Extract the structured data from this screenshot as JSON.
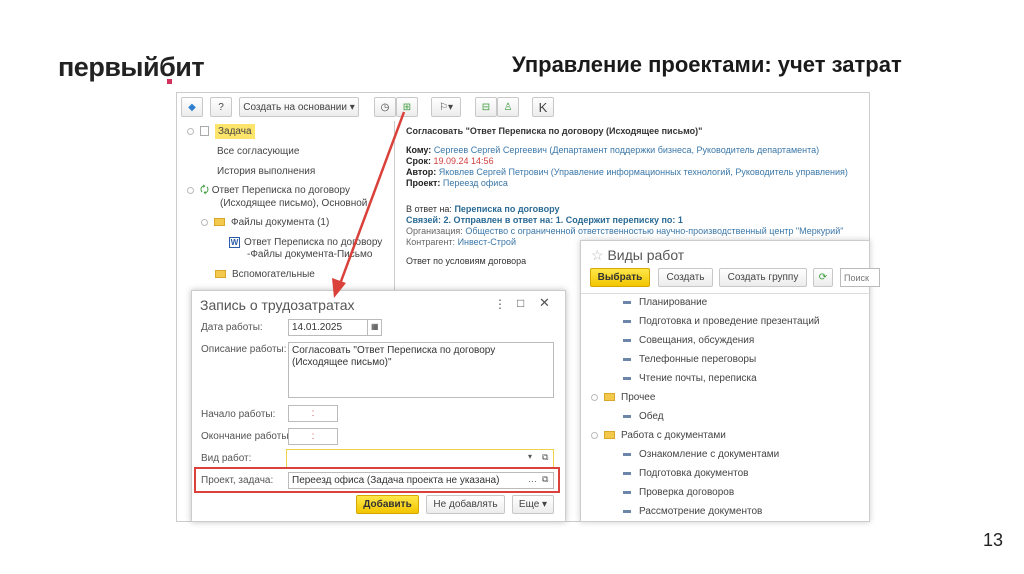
{
  "logo": {
    "text_a": "первый",
    "text_b": "бит",
    "accent": "#d2335c"
  },
  "slide": {
    "title": "Управление проектами: учет затрат",
    "page_number": "13"
  },
  "toolbar": {
    "create_based_on": "Создать на основании",
    "k_label": "K"
  },
  "tree": {
    "items": [
      {
        "label": "Задача"
      },
      {
        "label": "Все согласующие"
      },
      {
        "label": "История выполнения"
      },
      {
        "label": "Ответ Переписка по договору"
      },
      {
        "label": "(Исходящее письмо), Основной"
      },
      {
        "label": "Файлы документа (1)"
      },
      {
        "label": "Ответ Переписка по договору"
      },
      {
        "label": "-Файлы документа-Письмо"
      },
      {
        "label": "Вспомогательные"
      }
    ]
  },
  "task": {
    "heading": "Согласовать \"Ответ Переписка по договору (Исходящее письмо)\"",
    "to_label": "Кому:",
    "to_value": "Сергеев Сергей Сергеевич (Департамент поддержки бизнеса, Руководитель департамента)",
    "due_label": "Срок:",
    "due_value": "19.09.24 14:56",
    "author_label": "Автор:",
    "author_value": "Яковлев Сергей Петрович (Управление информационных технологий, Руководитель управления)",
    "project_label": "Проект:",
    "project_value": "Переезд офиса",
    "reply_label": "В ответ на:",
    "reply_value": "Переписка по договору",
    "links": "Связей: 2. Отправлен в ответ на: 1. Содержит переписку по: 1",
    "org_label": "Организация:",
    "org_value": "Общество с ограниченной ответственностью научно-производственный центр \"Меркурий\"",
    "contr_label": "Контрагент:",
    "contr_value": "Инвест-Строй",
    "note": "Ответ по условиям договора"
  },
  "dialog": {
    "title": "Запись о трудозатратах",
    "date_label": "Дата работы:",
    "date_value": "14.01.2025",
    "desc_label": "Описание работы:",
    "desc_value": "Согласовать \"Ответ Переписка по договору (Исходящее письмо)\"",
    "start_label": "Начало работы:",
    "start_value": ":",
    "end_label": "Окончание работы:",
    "end_value": ":",
    "kind_label": "Вид работ:",
    "kind_value": "",
    "project_label": "Проект, задача:",
    "project_value": "Переезд офиса (Задача проекта не указана)",
    "add": "Добавить",
    "dont_add": "Не добавлять",
    "more": "Еще",
    "highlight_color": "#d9413a"
  },
  "vidy": {
    "title": "Виды работ",
    "select": "Выбрать",
    "create": "Создать",
    "create_group": "Создать группу",
    "search_placeholder": "Поиск",
    "items": [
      {
        "label": "Планирование",
        "type": "item"
      },
      {
        "label": "Подготовка и проведение презентаций",
        "type": "item"
      },
      {
        "label": "Совещания, обсуждения",
        "type": "item"
      },
      {
        "label": "Телефонные переговоры",
        "type": "item"
      },
      {
        "label": "Чтение почты, переписка",
        "type": "item"
      },
      {
        "label": "Прочее",
        "type": "group"
      },
      {
        "label": "Обед",
        "type": "item"
      },
      {
        "label": "Работа с документами",
        "type": "group"
      },
      {
        "label": "Ознакомление с документами",
        "type": "item"
      },
      {
        "label": "Подготовка документов",
        "type": "item"
      },
      {
        "label": "Проверка договоров",
        "type": "item"
      },
      {
        "label": "Рассмотрение документов",
        "type": "item"
      }
    ]
  }
}
